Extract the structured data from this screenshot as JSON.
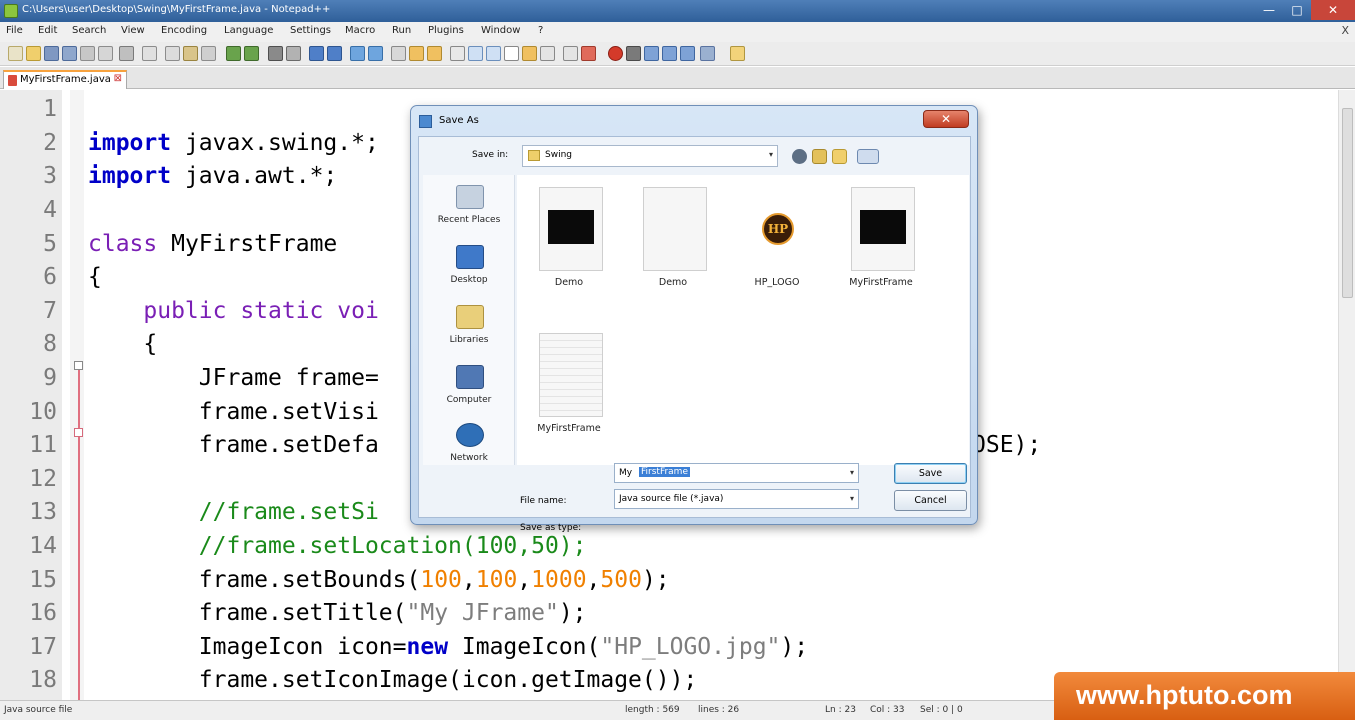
{
  "window": {
    "title": "C:\\Users\\user\\Desktop\\Swing\\MyFirstFrame.java - Notepad++",
    "min_icon": "minimize-icon",
    "max_icon": "maximize-icon",
    "close_icon": "close-icon",
    "min_glyph": "—",
    "max_glyph": "□",
    "close_glyph": "✕"
  },
  "menu": {
    "items": [
      "File",
      "Edit",
      "Search",
      "View",
      "Encoding",
      "Language",
      "Settings",
      "Macro",
      "Run",
      "Plugins",
      "Window",
      "?"
    ],
    "close_glyph": "X"
  },
  "tab": {
    "label": "MyFirstFrame.java",
    "close_glyph": "⊠"
  },
  "editor": {
    "line_numbers": [
      "1",
      "2",
      "3",
      "4",
      "5",
      "6",
      "7",
      "8",
      "9",
      "10",
      "11",
      "12",
      "13",
      "14",
      "15",
      "16",
      "17",
      "18"
    ],
    "lines": {
      "l2a": "import",
      "l2b": " javax.swing.*;",
      "l3a": "import",
      "l3b": " java.awt.*;",
      "l5a": "class",
      "l5b": " MyFirstFrame",
      "l6": "{",
      "l7a": "    public static voi",
      "l8": "    {",
      "l9": "        JFrame frame=",
      "l10": "        frame.setVisi",
      "l11a": "        frame.setDefa",
      "l11b": "OSE);",
      "l13": "        //frame.setSi",
      "l14": "        //frame.setLocation(100,50);",
      "l15a": "        frame.setBounds(",
      "l15n1": "100",
      "l15c1": ",",
      "l15n2": "100",
      "l15c2": ",",
      "l15n3": "1000",
      "l15c3": ",",
      "l15n4": "500",
      "l15e": ");",
      "l16a": "        frame.setTitle(",
      "l16s": "\"My JFrame\"",
      "l16e": ");",
      "l17a": "        ImageIcon icon=",
      "l17k": "new",
      "l17b": " ImageIcon(",
      "l17s": "\"HP_LOGO.jpg\"",
      "l17e": ");",
      "l18": "        frame.setIconImage(icon.getImage());"
    }
  },
  "status": {
    "file_type": "Java source file",
    "length": "length : 569",
    "lines": "lines : 26",
    "ln": "Ln : 23",
    "col": "Col : 33",
    "sel": "Sel : 0 | 0"
  },
  "watermark": "www.hptuto.com",
  "dialog": {
    "title": "Save As",
    "close_glyph": "✕",
    "save_in_label": "Save in:",
    "save_in_value": "Swing",
    "places": [
      "Recent Places",
      "Desktop",
      "Libraries",
      "Computer",
      "Network"
    ],
    "files": [
      "Demo",
      "Demo",
      "HP_LOGO",
      "MyFirstFrame",
      "MyFirstFrame"
    ],
    "hp_logo_text": "HP",
    "file_name_label": "File name:",
    "file_name_typed": "My",
    "file_name_selected": "FirstFrame",
    "save_as_type_label": "Save as type:",
    "save_as_type_value": "Java source file (*.java)",
    "save_button": "Save",
    "cancel_button": "Cancel",
    "dropdown_glyph": "▾"
  }
}
